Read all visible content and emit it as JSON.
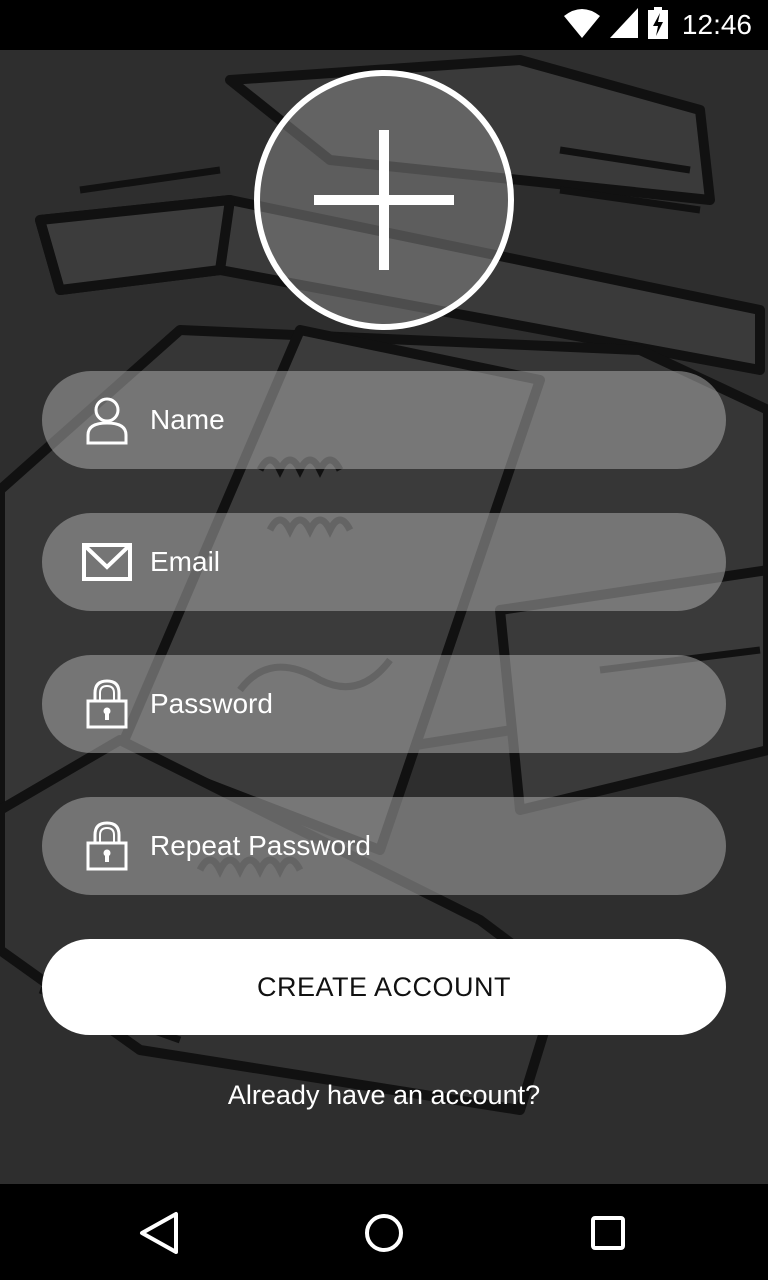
{
  "status_bar": {
    "time": "12:46",
    "icons": [
      "wifi-icon",
      "signal-icon",
      "battery-charging-icon"
    ]
  },
  "avatar": {
    "icon": "add-photo-plus-icon"
  },
  "form": {
    "name": {
      "placeholder": "Name",
      "value": "",
      "icon": "person-icon"
    },
    "email": {
      "placeholder": "Email",
      "value": "",
      "icon": "envelope-icon"
    },
    "password": {
      "placeholder": "Password",
      "value": "",
      "icon": "lock-icon"
    },
    "repeat_password": {
      "placeholder": "Repeat Password",
      "value": "",
      "icon": "lock-icon"
    }
  },
  "actions": {
    "create_account_label": "CREATE ACCOUNT",
    "login_link": "Already have an account?"
  },
  "nav_bar": {
    "buttons": [
      "back-icon",
      "home-icon",
      "recents-icon"
    ]
  },
  "colors": {
    "background": "#2e2e2e",
    "field_fill": "#8a8a8a",
    "button_fill": "#ffffff",
    "system_bars": "#000000"
  }
}
